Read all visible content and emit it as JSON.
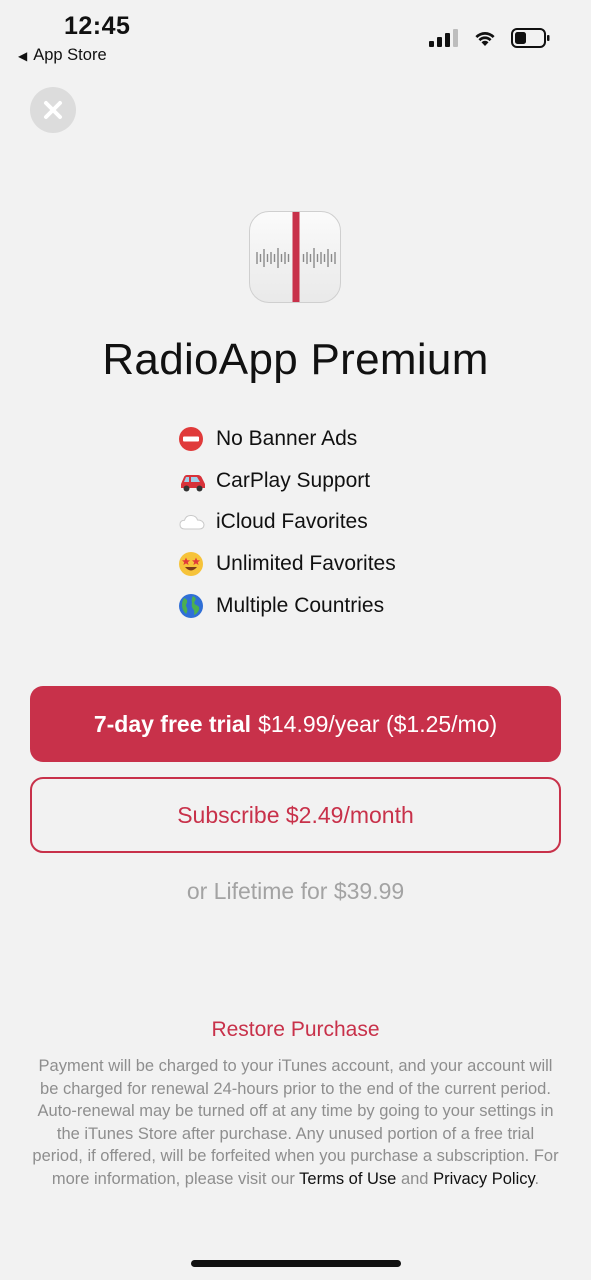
{
  "status": {
    "time": "12:45",
    "back_app": "App Store"
  },
  "app": {
    "title": "RadioApp Premium"
  },
  "features": [
    {
      "icon": "no-entry-icon",
      "label": "No Banner Ads"
    },
    {
      "icon": "car-icon",
      "label": "CarPlay Support"
    },
    {
      "icon": "cloud-icon",
      "label": "iCloud Favorites"
    },
    {
      "icon": "star-struck-icon",
      "label": "Unlimited Favorites"
    },
    {
      "icon": "globe-icon",
      "label": "Multiple Countries"
    }
  ],
  "offers": {
    "trial_bold": "7-day free trial",
    "trial_price": "$14.99/year ($1.25/mo)",
    "subscribe": "Subscribe $2.49/month",
    "lifetime": "or Lifetime for $39.99"
  },
  "footer": {
    "restore": "Restore Purchase",
    "legal_text": "Payment will be charged to your iTunes account, and your account will be charged for renewal 24-hours prior to the end of the current period. Auto-renewal may be turned off at any time by going to your settings in the iTunes Store after purchase. Any unused portion of a free trial period, if offered, will be forfeited when you purchase a subscription. For more information, please visit our",
    "terms": "Terms of Use",
    "and": "and",
    "privacy": "Privacy Policy",
    "period": "."
  },
  "colors": {
    "accent": "#c8314a",
    "background": "#f2f2f2",
    "muted": "#a3a3a3"
  }
}
